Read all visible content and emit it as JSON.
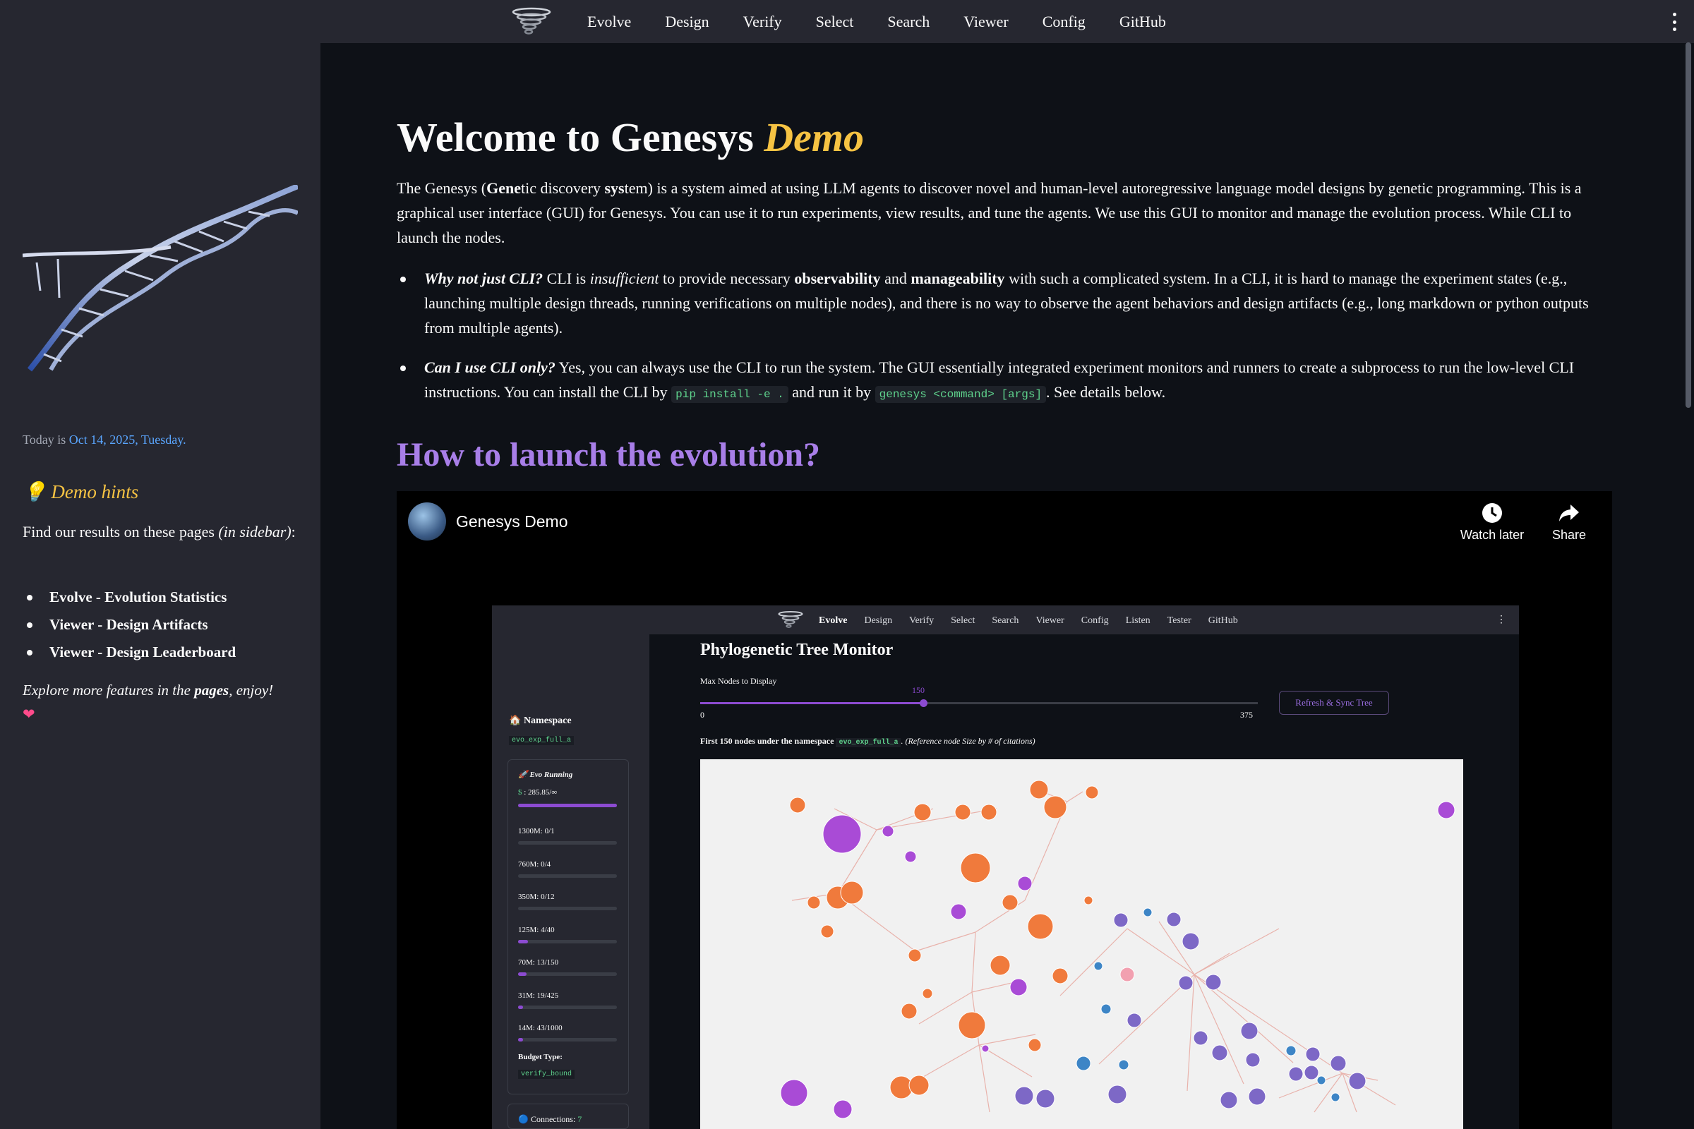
{
  "nav": {
    "items": [
      "Evolve",
      "Design",
      "Verify",
      "Select",
      "Search",
      "Viewer",
      "Config",
      "GitHub"
    ]
  },
  "sidebar": {
    "today_prefix": "Today is",
    "today_date": "Oct 14, 2025, Tuesday.",
    "hints_emoji": "💡",
    "hints_title": "Demo hints",
    "find_text": "Find our results on these pages ",
    "find_italic": "(in sidebar)",
    "find_colon": ":",
    "links": [
      "Evolve - Evolution Statistics",
      "Viewer - Design Artifacts",
      "Viewer - Design Leaderboard"
    ],
    "enjoy_1": "Explore more features in the ",
    "enjoy_bold": "pages",
    "enjoy_2": ", enjoy!",
    "heart": "❤"
  },
  "main": {
    "title_1": "Welcome to Genesys ",
    "title_demo": "Demo",
    "intro_1": "The Genesys (",
    "intro_gene": "Gene",
    "intro_2": "tic discovery ",
    "intro_sys": "sys",
    "intro_3": "tem) is a system aimed at using LLM agents to discover novel and human-level autoregressive language model designs by genetic programming. This is a graphical user interface (GUI) for Genesys. You can use it to run experiments, view results, and tune the agents. We use this GUI to monitor and manage the evolution process. While CLI to launch the nodes.",
    "b1_q": "Why not just CLI?",
    "b1_1": " CLI is ",
    "b1_insuff": "insufficient",
    "b1_2": " to provide necessary ",
    "b1_obs": "observability",
    "b1_3": " and ",
    "b1_man": "manageability",
    "b1_4": " with such a complicated system. In a CLI, it is hard to manage the experiment states (e.g., launching multiple design threads, running verifications on multiple nodes), and there is no way to observe the agent behaviors and design artifacts (e.g., long markdown or python outputs from multiple agents).",
    "b2_q": "Can I use CLI only?",
    "b2_1": " Yes, you can always use the CLI to run the system. The GUI essentially integrated experiment monitors and runners to create a subprocess to run the low-level CLI instructions. You can install the CLI by ",
    "b2_code1": "pip install -e .",
    "b2_2": " and run it by ",
    "b2_code2": "genesys <command> [args]",
    "b2_3": ". See details below.",
    "h2": "How to launch the evolution?"
  },
  "video": {
    "title": "Genesys Demo",
    "watch_later": "Watch later",
    "share": "Share",
    "inner": {
      "nav": [
        "Evolve",
        "Design",
        "Verify",
        "Select",
        "Search",
        "Viewer",
        "Config",
        "Listen",
        "Tester",
        "GitHub"
      ],
      "namespace_label": "Namespace",
      "namespace_value": "evo_exp_full_a",
      "evo_running": "Evo Running",
      "budget": ": 285.85/∞",
      "rows": [
        {
          "label": "1300M: 0/1",
          "fill": 0
        },
        {
          "label": "760M: 0/4",
          "fill": 0
        },
        {
          "label": "350M: 0/12",
          "fill": 0
        },
        {
          "label": "125M: 4/40",
          "fill": 0.1
        },
        {
          "label": "70M: 13/150",
          "fill": 0.087
        },
        {
          "label": "31M: 19/425",
          "fill": 0.045
        },
        {
          "label": "14M: 43/1000",
          "fill": 0.043
        }
      ],
      "budget_type_label": "Budget Type:",
      "budget_type_value": "verify_bound",
      "connections": "Connections:",
      "connections_count": "7",
      "panel_title": "Phylogenetic Tree Monitor",
      "max_nodes_label": "Max Nodes to Display",
      "slider_value": "150",
      "slider_min": "0",
      "slider_max": "375",
      "refresh_button": "Refresh & Sync Tree",
      "first_nodes_1": "First 150 nodes under the namespace ",
      "first_nodes_code": "evo_exp_full_a",
      "first_nodes_2": ". (Reference node Size by # of citations)"
    }
  }
}
